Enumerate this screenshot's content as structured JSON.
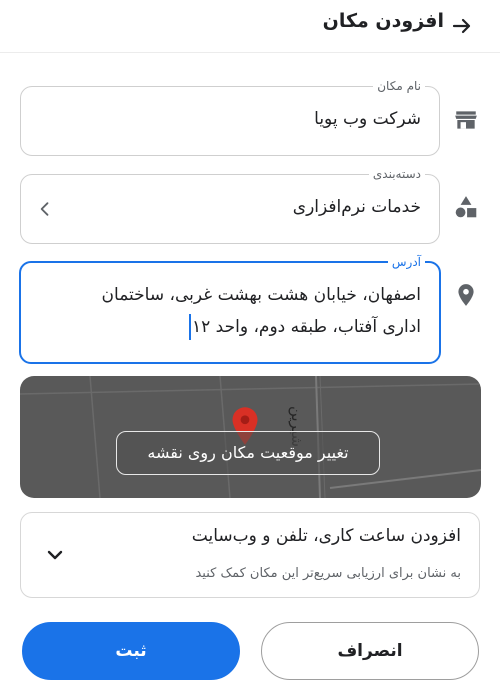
{
  "header": {
    "title": "افزودن مکان",
    "back_icon": "arrow-back-icon"
  },
  "fields": {
    "name": {
      "label": "نام مکان",
      "value": "شرکت وب پویا",
      "icon": "store-icon"
    },
    "category": {
      "label": "دسته‌بندی",
      "value": "خدمات نرم‌افزاری",
      "icon": "category-icon"
    },
    "address": {
      "label": "آدرس",
      "line1": "اصفهان، خیابان هشت بهشت غربی، ساختمان",
      "line2": "اداری آفتاب، طبقه دوم، واحد ۱۲",
      "icon": "location-pin-icon"
    }
  },
  "map": {
    "street_label": "شیرین",
    "button_label": "تغییر موقعیت مکان روی نقشه"
  },
  "hours": {
    "title": "افزودن ساعت کاری، تلفن و وب‌سایت",
    "subtitle": "به نشان برای ارزیابی سریع‌تر این مکان کمک کنید"
  },
  "actions": {
    "submit_label": "ثبت",
    "cancel_label": "انصراف"
  },
  "colors": {
    "accent": "#1a73e8",
    "map_bg": "#595959",
    "pin": "#d93025"
  }
}
